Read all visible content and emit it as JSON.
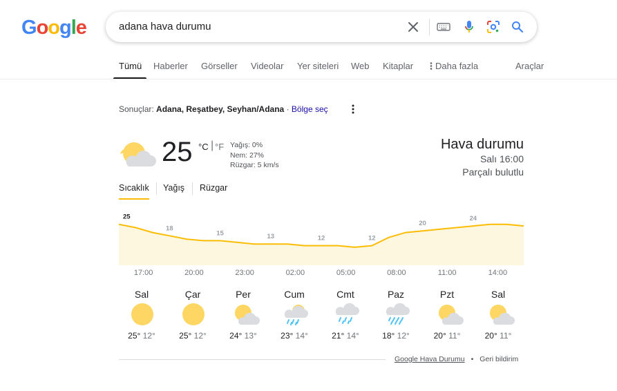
{
  "search": {
    "query": "adana hava durumu"
  },
  "logo": {
    "letters": [
      "G",
      "o",
      "o",
      "g",
      "l",
      "e"
    ],
    "colors": [
      "#4285f4",
      "#ea4335",
      "#fbbc05",
      "#4285f4",
      "#34a853",
      "#ea4335"
    ]
  },
  "tabs": [
    {
      "label": "Tümü",
      "active": true
    },
    {
      "label": "Haberler"
    },
    {
      "label": "Görseller"
    },
    {
      "label": "Videolar"
    },
    {
      "label": "Yer siteleri"
    },
    {
      "label": "Web"
    },
    {
      "label": "Kitaplar"
    },
    {
      "label": "Daha fazla"
    },
    {
      "label": "Araçlar"
    }
  ],
  "results_for": {
    "prefix": "Sonuçlar:",
    "location": "Adana, Reşatbey, Seyhan/Adana",
    "separator": "·",
    "link": "Bölge seç"
  },
  "current": {
    "temp": "25",
    "unit_c": "°C",
    "unit_sep": "|",
    "unit_f": "°F",
    "precip": "Yağış: 0%",
    "humidity": "Nem: 27%",
    "wind": "Rüzgar: 5 km/s",
    "icon": "partly-cloudy-icon"
  },
  "header": {
    "title": "Hava durumu",
    "time": "Salı 16:00",
    "condition": "Parçalı bulutlu"
  },
  "metric_tabs": [
    {
      "label": "Sıcaklık",
      "active": true
    },
    {
      "label": "Yağış"
    },
    {
      "label": "Rüzgar"
    }
  ],
  "chart_data": {
    "type": "area",
    "title": "",
    "x": [
      "17:00",
      "18:00",
      "19:00",
      "20:00",
      "21:00",
      "22:00",
      "23:00",
      "00:00",
      "01:00",
      "02:00",
      "03:00",
      "04:00",
      "05:00",
      "06:00",
      "07:00",
      "08:00",
      "09:00",
      "10:00",
      "11:00",
      "12:00",
      "13:00",
      "14:00",
      "15:00",
      "16:00",
      "17:00"
    ],
    "values": [
      25,
      23,
      20,
      18,
      16,
      15,
      15,
      14,
      13,
      13,
      13,
      12,
      12,
      12,
      11,
      12,
      17,
      20,
      21,
      22,
      23,
      24,
      25,
      25,
      24
    ],
    "point_labels": [
      25,
      null,
      null,
      18,
      null,
      null,
      15,
      null,
      null,
      13,
      null,
      null,
      12,
      null,
      null,
      12,
      null,
      null,
      20,
      null,
      null,
      24,
      null,
      null,
      null
    ],
    "tick_labels": [
      "17:00",
      "20:00",
      "23:00",
      "02:00",
      "05:00",
      "08:00",
      "11:00",
      "14:00"
    ],
    "ylim": [
      0,
      27
    ],
    "line_color": "#fbbc04",
    "fill_color": "#fef7e0"
  },
  "days": [
    {
      "name": "Sal",
      "hi": "25°",
      "lo": "12°",
      "icon": "sunny-icon",
      "selected": true
    },
    {
      "name": "Çar",
      "hi": "25°",
      "lo": "12°",
      "icon": "sunny-icon"
    },
    {
      "name": "Per",
      "hi": "24°",
      "lo": "13°",
      "icon": "partly-cloudy-icon"
    },
    {
      "name": "Cum",
      "hi": "23°",
      "lo": "14°",
      "icon": "rain-cloudy-icon"
    },
    {
      "name": "Cmt",
      "hi": "21°",
      "lo": "14°",
      "icon": "rain-icon"
    },
    {
      "name": "Paz",
      "hi": "18°",
      "lo": "12°",
      "icon": "heavy-rain-icon"
    },
    {
      "name": "Pzt",
      "hi": "20°",
      "lo": "11°",
      "icon": "partly-cloudy-icon"
    },
    {
      "name": "Sal",
      "hi": "20°",
      "lo": "11°",
      "icon": "partly-cloudy-icon"
    }
  ],
  "footer": {
    "source": "Google Hava Durumu",
    "dot": "•",
    "feedback": "Geri bildirim"
  }
}
